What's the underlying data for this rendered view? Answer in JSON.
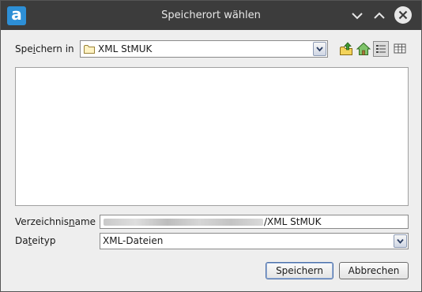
{
  "window": {
    "title": "Speicherort wählen",
    "app_icon_letter": "a",
    "titlebar_color": "#3c3c3c",
    "accent_color": "#2d8fd6"
  },
  "look_in": {
    "label_before": "Spe",
    "label_mnemonic": "i",
    "label_after": "chern in",
    "selected_folder": "XML StMUK"
  },
  "toolbar": {
    "icons": [
      "up-folder-icon",
      "home-icon",
      "list-view-icon",
      "details-view-icon"
    ]
  },
  "folder_name": {
    "label_before": "Verzeichnis",
    "label_mnemonic": "n",
    "label_after": "ame",
    "value_suffix": "/XML StMUK"
  },
  "file_type": {
    "label_before": "Da",
    "label_mnemonic": "t",
    "label_after": "eityp",
    "selected": "XML-Dateien"
  },
  "buttons": {
    "save": "Speichern",
    "cancel": "Abbrechen"
  }
}
